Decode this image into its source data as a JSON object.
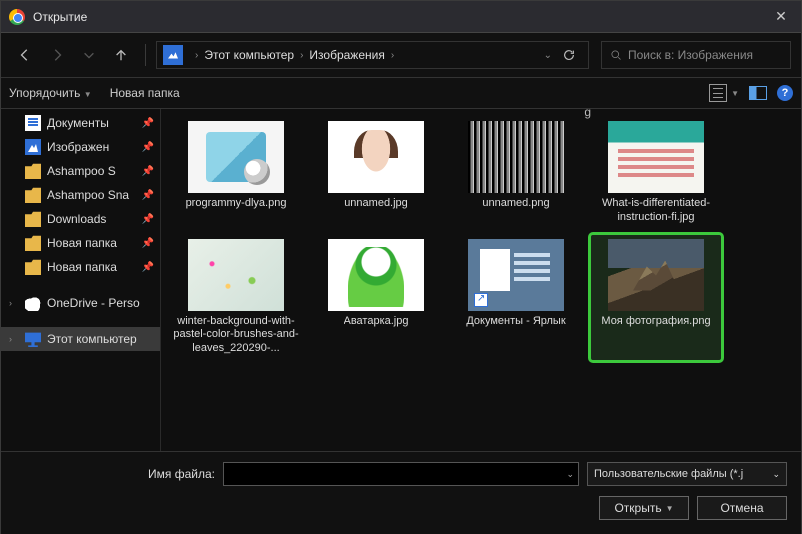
{
  "title": "Открытие",
  "breadcrumb": {
    "root": "Этот компьютер",
    "folder": "Изображения"
  },
  "search_placeholder": "Поиск в: Изображения",
  "toolbar": {
    "organize": "Упорядочить",
    "newfolder": "Новая папка"
  },
  "sidebar": [
    {
      "icon": "doc",
      "label": "Документы",
      "pinned": true
    },
    {
      "icon": "pic",
      "label": "Изображен",
      "pinned": true
    },
    {
      "icon": "folder",
      "label": "Ashampoo S",
      "pinned": true
    },
    {
      "icon": "folder",
      "label": "Ashampoo Sna",
      "pinned": true
    },
    {
      "icon": "folder",
      "label": "Downloads",
      "pinned": true
    },
    {
      "icon": "folder",
      "label": "Новая папка",
      "pinned": true
    },
    {
      "icon": "folder",
      "label": "Новая папка",
      "pinned": true
    },
    {
      "icon": "cloud",
      "label": "OneDrive - Perso",
      "chev": true
    },
    {
      "icon": "pc",
      "label": "Этот компьютер",
      "chev": true,
      "sel": true
    }
  ],
  "files": [
    {
      "thumb": "software white",
      "label": "programmy-dlya.png"
    },
    {
      "thumb": "face white",
      "label": "unnamed.jpg"
    },
    {
      "thumb": "noise",
      "label": "unnamed.png"
    },
    {
      "thumb": "diff",
      "label": "What-is-differentiated-instruction-fi.jpg"
    },
    {
      "thumb": "winter",
      "label": "winter-background-with-pastel-color-brushes-and-leaves_220290-..."
    },
    {
      "thumb": "avatar white",
      "label": "Аватарка.jpg"
    },
    {
      "thumb": "bigdoc",
      "label": "Документы - Ярлык",
      "link": true
    },
    {
      "thumb": "photo",
      "label": "Моя фотография.png",
      "selected": true
    }
  ],
  "filename_label": "Имя файла:",
  "type_filter": "Пользовательские файлы (*.j",
  "open_label": "Открыть",
  "cancel_label": "Отмена"
}
